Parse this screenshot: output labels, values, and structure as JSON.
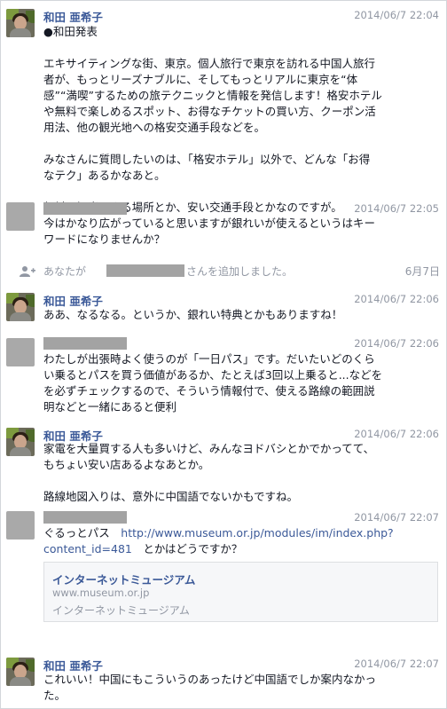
{
  "messages": [
    {
      "sender": "和田 亜希子",
      "time": "2014/06/7 22:04",
      "text": "●和田発表\n\nエキサイティングな街、東京。個人旅行で東京を訪れる中国人旅行\n者が、もっとリーズナブルに、そしてもっとリアルに東京を“体\n感”“満喫”するための旅テクニックと情報を発信します！格安ホテル\nや無料で楽しめるスポット、お得なチケットの買い方、クーポン活\n用法、他の観光地への格安交通手段などを。\n\nみなさんに質問したいのは、「格安ホテル」以外で、どんな「お得\nなテク」あるかなあと。\n\n無料で観光できる場所とか、安い交通手段とかなのですが。"
    },
    {
      "time": "2014/06/7 22:05",
      "text": "今はかなり広がっていると思いますが銀れいが使えるというはキー\nワードになりませんか？"
    },
    {
      "sender": "和田 亜希子",
      "time": "2014/06/7 22:06",
      "text": "ああ、なるなる。というか、銀れい特典とかもありますね！"
    },
    {
      "time": "2014/06/7 22:06",
      "text": "わたしが出張時よく使うのが「一日パス」です。だいたいどのくら\nい乗るとパスを買う価値があるか、たとえば3回以上乗ると...などを\nを必ずチェックするので、そういう情報付で、使える路線の範囲説\n明などと一緒にあると便利"
    },
    {
      "sender": "和田 亜希子",
      "time": "2014/06/7 22:06",
      "text": "家電を大量買する人も多いけど、みんなヨドバシとかでかってて、\nもちょい安い店あるよなあとか。\n\n路線地図入りは、意外に中国語でないかもですね。"
    },
    {
      "time": "2014/06/7 22:07",
      "text_before": "ぐるっとパス　",
      "link": "http://www.museum.or.jp/modules/im/index.php?\ncontent_id=481",
      "text_after": "　とかはどうですか？"
    },
    {
      "sender": "和田 亜希子",
      "time": "2014/06/7 22:07",
      "text": "これいい！中国にもこういうのあったけど中国語でしか案内なかっ\nた。"
    }
  ],
  "system": {
    "pre": "あなたが",
    "post": "さんを追加しました。",
    "date": "6月7日",
    "icon": "add-person-icon"
  },
  "preview": {
    "title": "インターネットミュージアム",
    "domain": "www.museum.or.jp",
    "description": "インターネットミュージアム"
  },
  "colors": {
    "name": "#3b5998",
    "meta": "#9197a3",
    "redacted": "#a3a3a3"
  }
}
